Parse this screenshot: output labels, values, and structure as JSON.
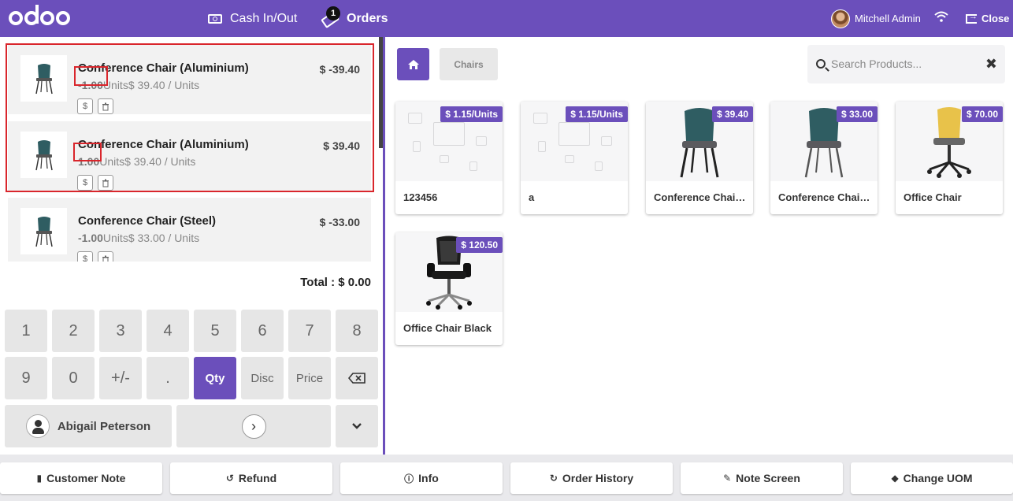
{
  "header": {
    "logo_text": "odoo",
    "cash_label": "Cash In/Out",
    "orders_label": "Orders",
    "orders_badge": "1",
    "user_name": "Mitchell Admin",
    "close_label": "Close"
  },
  "order_lines": [
    {
      "name": "Conference Chair (Aluminium)",
      "qty": "-1.00",
      "unit_info": "Units$ 39.40 / Units",
      "price": "$ -39.40"
    },
    {
      "name": "Conference Chair (Aluminium)",
      "qty": "1.00",
      "unit_info": "Units$ 39.40 / Units",
      "price": "$ 39.40"
    },
    {
      "name": "Conference Chair (Steel)",
      "qty": "-1.00",
      "unit_info": "Units$ 33.00 / Units",
      "price": "$ -33.00"
    }
  ],
  "line_buttons": {
    "price_icon": "$",
    "delete_icon": "trash-icon"
  },
  "total_label": "Total : $ 0.00",
  "numpad": {
    "row1": [
      "1",
      "2",
      "3",
      "4",
      "5",
      "6",
      "7",
      "8"
    ],
    "row2": [
      "9",
      "0",
      "+/-",
      ".",
      "Qty",
      "Disc",
      "Price"
    ],
    "active_mode": "Qty",
    "customer": "Abigail Peterson"
  },
  "category": {
    "home_icon": "home-icon",
    "current": "Chairs"
  },
  "search": {
    "placeholder": "Search Products...",
    "value": ""
  },
  "products": [
    {
      "name": "123456",
      "price": "$ 1.15/Units"
    },
    {
      "name": "a",
      "price": "$ 1.15/Units"
    },
    {
      "name": "Conference Chair...",
      "price": "$ 39.40"
    },
    {
      "name": "Conference Chair...",
      "price": "$ 33.00"
    },
    {
      "name": "Office Chair",
      "price": "$ 70.00"
    },
    {
      "name": "Office Chair Black",
      "price": "$ 120.50"
    }
  ],
  "footer": {
    "customer_note": "Customer Note",
    "refund": "Refund",
    "info": "Info",
    "order_history": "Order History",
    "note_screen": "Note Screen",
    "change_uom": "Change UOM"
  },
  "colors": {
    "brand": "#6b4fbb",
    "highlight_box": "#d9262c"
  }
}
